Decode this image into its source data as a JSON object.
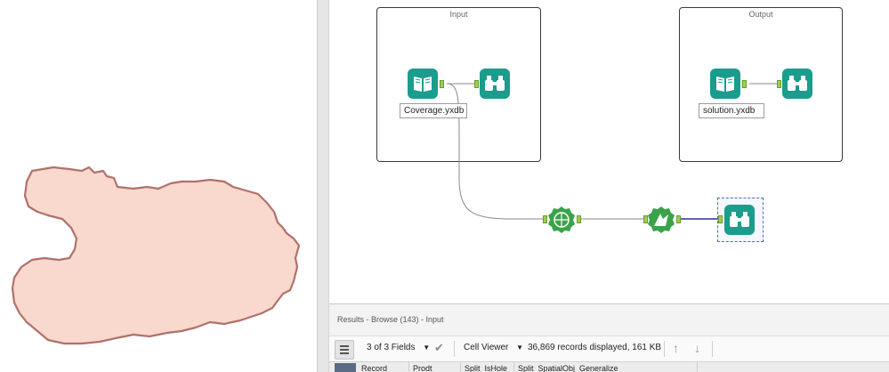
{
  "canvas": {
    "input_container": {
      "title": "Input"
    },
    "output_container": {
      "title": "Output"
    },
    "input_label": "Coverage.yxdb",
    "output_label": "solution.yxdb"
  },
  "icons": {
    "input_data": "book-icon",
    "browse": "binoculars-icon",
    "spatial_process": "spatial-process-icon",
    "generalize": "generalize-icon"
  },
  "colors": {
    "tool_teal": "#1a9d8d",
    "tool_green": "#3aa34a",
    "anchor": "#9bcf4f",
    "shape_fill": "#f9d8cd",
    "shape_stroke": "#b0706b",
    "selected_connection": "#2b2b9a"
  },
  "results": {
    "title": "Results - Browse (143) - Input",
    "fields_label": "3 of 3 Fields",
    "cell_viewer_label": "Cell Viewer",
    "records_text": "36,869 records displayed, 161 KB",
    "columns": [
      "Record",
      "Prodt",
      "Split_IsHole",
      "Split_SpatialObj_Generalize"
    ]
  }
}
